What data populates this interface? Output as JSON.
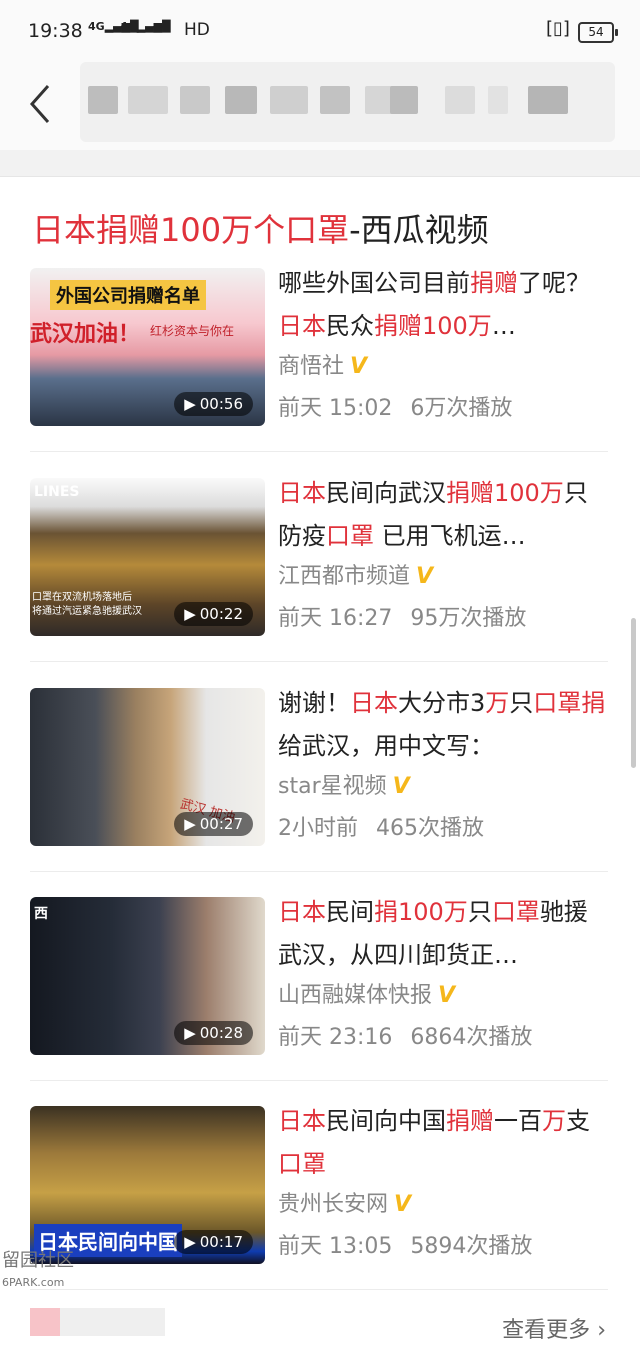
{
  "status_bar": {
    "time": "19:38",
    "signal1": "4G",
    "signal2": "4G",
    "hd": "HD",
    "battery": "54"
  },
  "nav": {
    "back_icon": "chevron-left-icon"
  },
  "section": {
    "title_highlight": "日本捐赠100万个口罩",
    "title_rest": "-西瓜视频"
  },
  "colors": {
    "highlight": "#e0323b",
    "verified": "#f5b71b"
  },
  "videos": [
    {
      "title_parts": [
        {
          "t": "哪些外国公司目前",
          "h": false
        },
        {
          "t": "捐赠",
          "h": true
        },
        {
          "t": "了呢？",
          "h": false
        },
        {
          "t": "日本",
          "h": true
        },
        {
          "t": "民众",
          "h": false
        },
        {
          "t": "捐赠",
          "h": true
        },
        {
          "t": "100万",
          "h": true
        },
        {
          "t": "…",
          "h": false
        }
      ],
      "source": "商悟社",
      "verified_mark": "V",
      "time": "前天 15:02",
      "views": "6万次播放",
      "duration": "00:56",
      "thumb_caption_top": "外国公司捐赠名单",
      "thumb_caption_mid": "武汉加油！",
      "thumb_caption_side": "红杉资本与你在"
    },
    {
      "title_parts": [
        {
          "t": "日本",
          "h": true
        },
        {
          "t": "民间向武汉",
          "h": false
        },
        {
          "t": "捐赠",
          "h": true
        },
        {
          "t": "100万",
          "h": true
        },
        {
          "t": "只防疫",
          "h": false
        },
        {
          "t": "口罩",
          "h": true
        },
        {
          "t": " 已用飞机运…",
          "h": false
        }
      ],
      "source": "江西都市频道",
      "verified_mark": "V",
      "time": "前天 16:27",
      "views": "95万次播放",
      "duration": "00:22",
      "thumb_caption_top": "LINES",
      "thumb_caption_mid": "口罩在双流机场落地后",
      "thumb_caption_side": "将通过汽运紧急驰援武汉"
    },
    {
      "title_parts": [
        {
          "t": "谢谢！",
          "h": false
        },
        {
          "t": "日本",
          "h": true
        },
        {
          "t": "大分市3",
          "h": false
        },
        {
          "t": "万",
          "h": true
        },
        {
          "t": "只",
          "h": false
        },
        {
          "t": "口罩",
          "h": true
        },
        {
          "t": "捐",
          "h": true
        },
        {
          "t": "给武汉，用中文写：",
          "h": false
        }
      ],
      "source": "star星视频",
      "verified_mark": "V",
      "time": "2小时前",
      "views": "465次播放",
      "duration": "00:27",
      "thumb_caption_top": "",
      "thumb_caption_mid": "武汉 加油",
      "thumb_caption_side": ""
    },
    {
      "title_parts": [
        {
          "t": "日本",
          "h": true
        },
        {
          "t": "民间",
          "h": false
        },
        {
          "t": "捐",
          "h": true
        },
        {
          "t": "100万",
          "h": true
        },
        {
          "t": "只",
          "h": false
        },
        {
          "t": "口罩",
          "h": true
        },
        {
          "t": "驰援武汉，从四川卸货正…",
          "h": false
        }
      ],
      "source": "山西融媒体快报",
      "verified_mark": "V",
      "time": "前天 23:16",
      "views": "6864次播放",
      "duration": "00:28",
      "thumb_caption_top": "西",
      "thumb_caption_mid": "",
      "thumb_caption_side": ""
    },
    {
      "title_parts": [
        {
          "t": "日本",
          "h": true
        },
        {
          "t": "民间向中国",
          "h": false
        },
        {
          "t": "捐赠",
          "h": true
        },
        {
          "t": "一百",
          "h": false
        },
        {
          "t": "万",
          "h": true
        },
        {
          "t": "支",
          "h": false
        },
        {
          "t": "口罩",
          "h": true
        }
      ],
      "source": "贵州长安网",
      "verified_mark": "V",
      "time": "前天 13:05",
      "views": "5894次播放",
      "duration": "00:17",
      "thumb_caption_top": "",
      "thumb_caption_mid": "日本民间向中国",
      "thumb_caption_side": ""
    }
  ],
  "footer": {
    "more_label": "查看更多",
    "more_icon": "chevron-right-icon"
  },
  "watermark": {
    "line1": "留园社区",
    "line2": "6PARK.com"
  }
}
